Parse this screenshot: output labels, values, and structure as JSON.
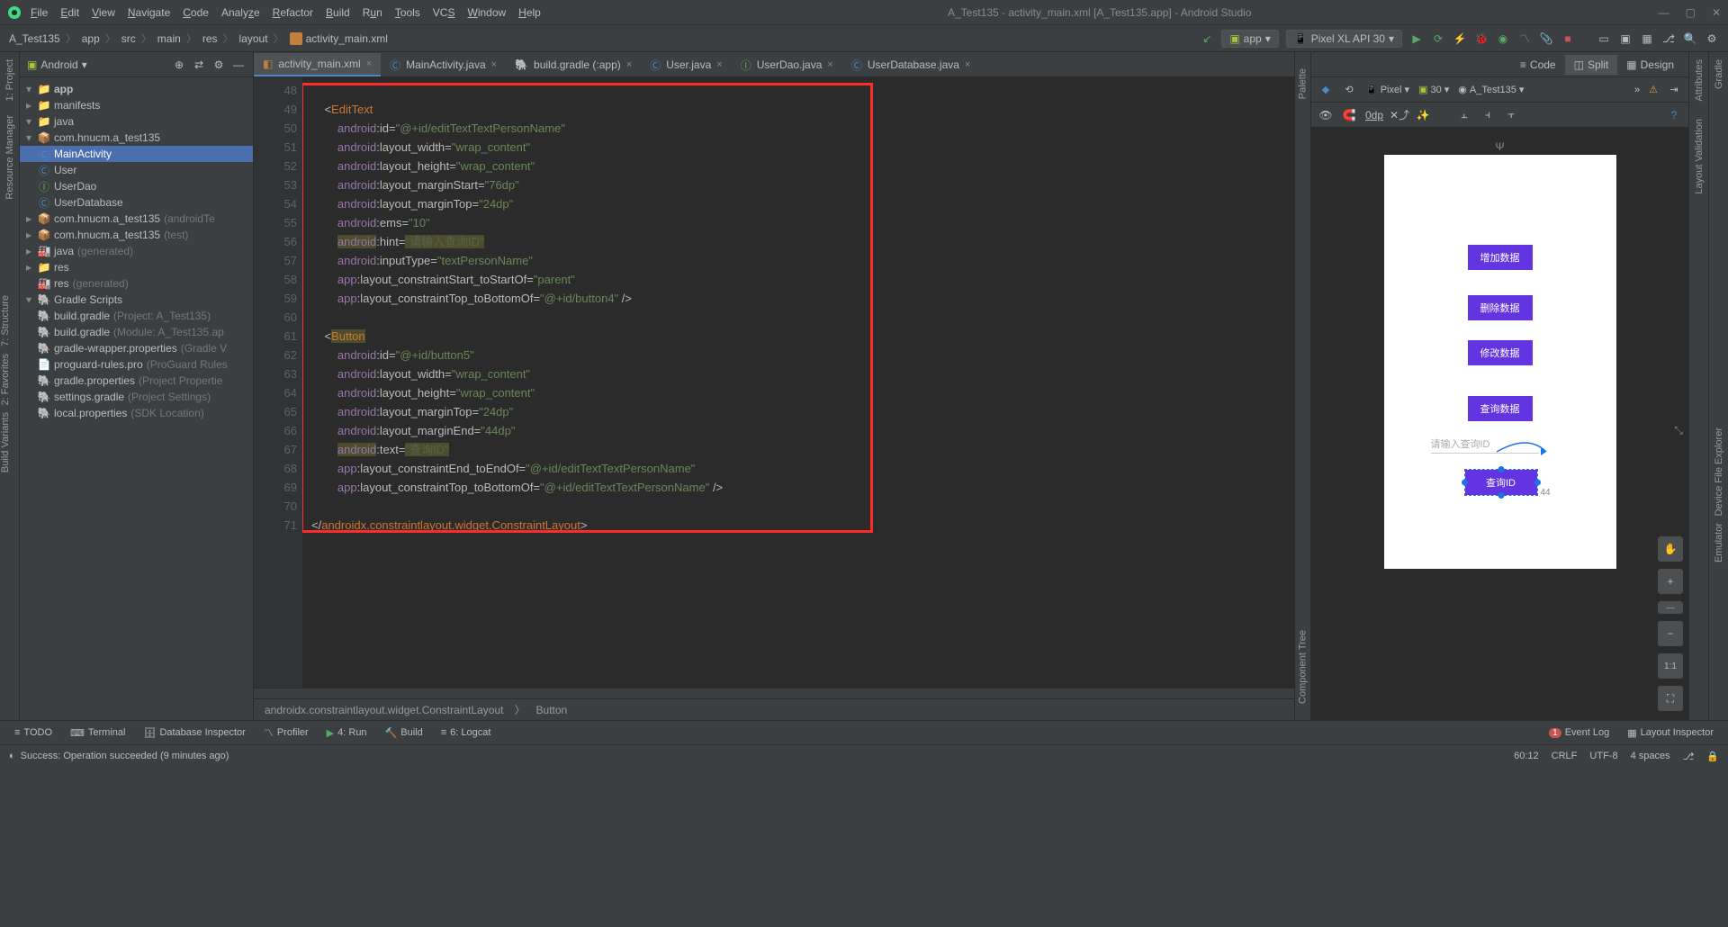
{
  "window": {
    "title": "A_Test135 - activity_main.xml [A_Test135.app] - Android Studio"
  },
  "menus": [
    "File",
    "Edit",
    "View",
    "Navigate",
    "Code",
    "Analyze",
    "Refactor",
    "Build",
    "Run",
    "Tools",
    "VCS",
    "Window",
    "Help"
  ],
  "breadcrumb": [
    "A_Test135",
    "app",
    "src",
    "main",
    "res",
    "layout",
    "activity_main.xml"
  ],
  "run_config": "app",
  "device": "Pixel XL API 30",
  "left_strip": {
    "project": "1: Project",
    "resmgr": "Resource Manager",
    "structure": "7: Structure",
    "favorites": "2: Favorites",
    "buildvar": "Build Variants"
  },
  "project_header": "Android",
  "tree": {
    "app": "app",
    "manifests": "manifests",
    "java": "java",
    "pkg": "com.hnucm.a_test135",
    "mainact": "MainActivity",
    "user": "User",
    "userdao": "UserDao",
    "userdb": "UserDatabase",
    "pkg_at": "com.hnucm.a_test135",
    "pkg_at_suffix": " (androidTe",
    "pkg_t": "com.hnucm.a_test135",
    "pkg_t_suffix": " (test)",
    "javagen": "java",
    "javagen_suffix": " (generated)",
    "res": "res",
    "resgen": "res",
    "resgen_suffix": " (generated)",
    "gradle_scripts": "Gradle Scripts",
    "bg_proj": "build.gradle",
    "bg_proj_suffix": " (Project: A_Test135)",
    "bg_mod": "build.gradle",
    "bg_mod_suffix": " (Module: A_Test135.ap",
    "gwp": "gradle-wrapper.properties",
    "gwp_suffix": " (Gradle V",
    "pgr": "proguard-rules.pro",
    "pgr_suffix": " (ProGuard Rules",
    "gp": "gradle.properties",
    "gp_suffix": " (Project Propertie",
    "sg": "settings.gradle",
    "sg_suffix": " (Project Settings)",
    "lp": "local.properties",
    "lp_suffix": " (SDK Location)"
  },
  "tabs": [
    {
      "label": "activity_main.xml",
      "icon": "xml",
      "active": true
    },
    {
      "label": "MainActivity.java",
      "icon": "java"
    },
    {
      "label": "build.gradle (:app)",
      "icon": "gradle"
    },
    {
      "label": "User.java",
      "icon": "java"
    },
    {
      "label": "UserDao.java",
      "icon": "java"
    },
    {
      "label": "UserDatabase.java",
      "icon": "java"
    }
  ],
  "gutter_start": 48,
  "code_lines": [
    "",
    "    <EditText",
    "        android:id=\"@+id/editTextTextPersonName\"",
    "        android:layout_width=\"wrap_content\"",
    "        android:layout_height=\"wrap_content\"",
    "        android:layout_marginStart=\"76dp\"",
    "        android:layout_marginTop=\"24dp\"",
    "        android:ems=\"10\"",
    "        android:hint=\"请输入查询ID\"",
    "        android:inputType=\"textPersonName\"",
    "        app:layout_constraintStart_toStartOf=\"parent\"",
    "        app:layout_constraintTop_toBottomOf=\"@+id/button4\" />",
    "",
    "    <Button",
    "        android:id=\"@+id/button5\"",
    "        android:layout_width=\"wrap_content\"",
    "        android:layout_height=\"wrap_content\"",
    "        android:layout_marginTop=\"24dp\"",
    "        android:layout_marginEnd=\"44dp\"",
    "        android:text=\"查询ID\"",
    "        app:layout_constraintEnd_toEndOf=\"@+id/editTextTextPersonName\"",
    "        app:layout_constraintTop_toBottomOf=\"@+id/editTextTextPersonName\" />",
    "",
    "</androidx.constraintlayout.widget.ConstraintLayout>"
  ],
  "editor_crumb": [
    "androidx.constraintlayout.widget.ConstraintLayout",
    "Button"
  ],
  "design": {
    "tabs": {
      "code": "Code",
      "split": "Split",
      "design": "Design"
    },
    "toolbar": {
      "pixel": "Pixel",
      "api": "30",
      "theme": "A_Test135"
    },
    "zoom": "0dp",
    "preview": {
      "btn1": "增加数据",
      "btn2": "删除数据",
      "btn3": "修改数据",
      "btn4": "查询数据",
      "hint": "请输入查询ID",
      "btn5": "查询ID",
      "dim_end": "44"
    }
  },
  "right_strip": {
    "gradle": "Gradle",
    "attributes": "Attributes",
    "validation": "Layout Validation",
    "devfile": "Device File Explorer",
    "emulator": "Emulator"
  },
  "bottom_tools": {
    "todo": "TODO",
    "terminal": "Terminal",
    "dbinsp": "Database Inspector",
    "profiler": "Profiler",
    "run": "4: Run",
    "build": "Build",
    "logcat": "6: Logcat",
    "eventlog": "Event Log",
    "layoutinsp": "Layout Inspector",
    "event_count": "1"
  },
  "status": {
    "msg": "Success: Operation succeeded (9 minutes ago)",
    "pos": "60:12",
    "crlf": "CRLF",
    "enc": "UTF-8",
    "indent": "4 spaces",
    "branch": ""
  },
  "side_labels": {
    "palette": "Palette",
    "comptree": "Component Tree"
  }
}
